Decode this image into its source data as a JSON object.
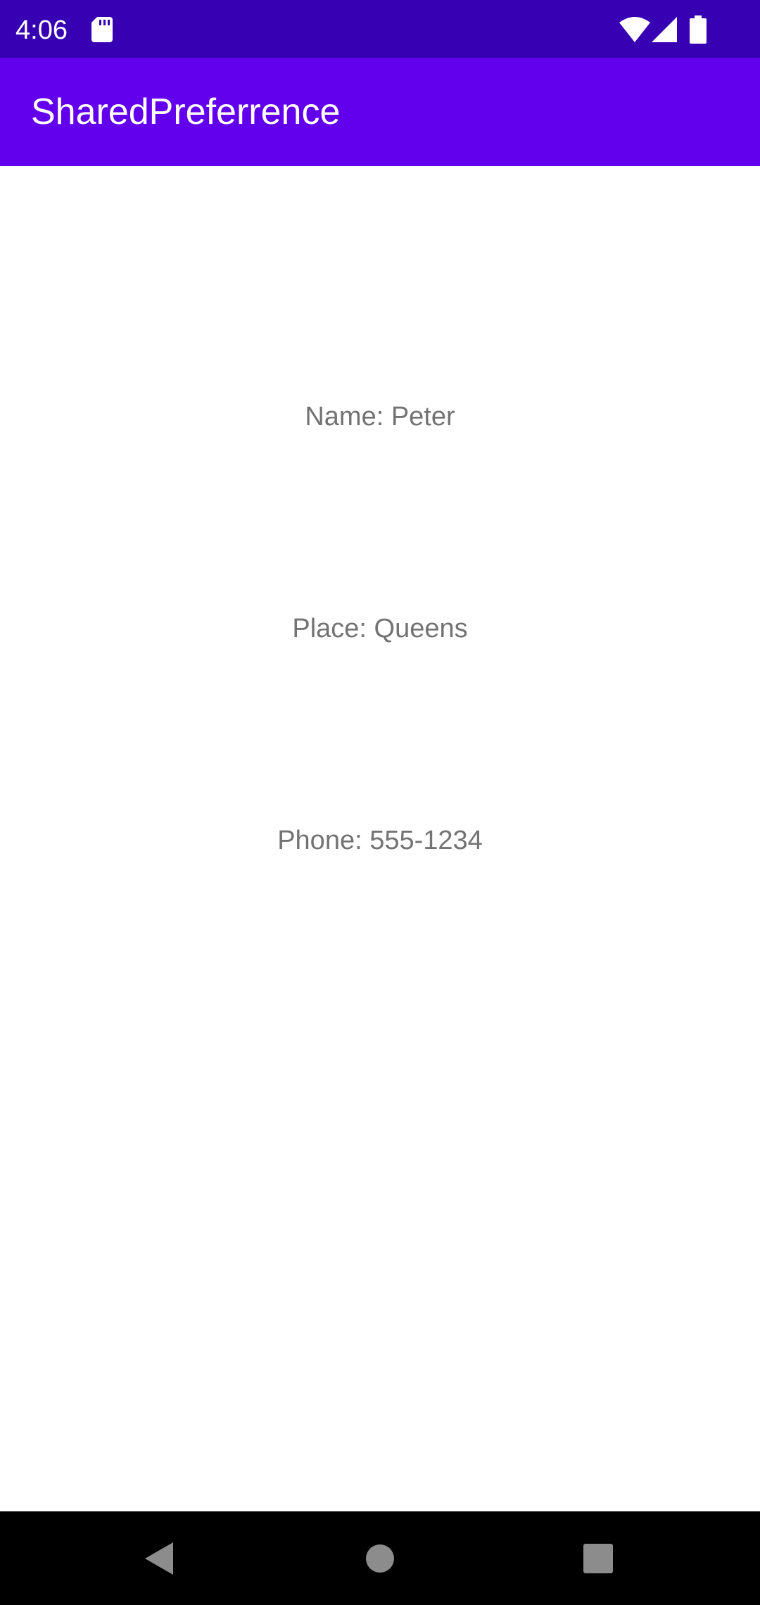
{
  "status_bar": {
    "time": "4:06",
    "icons": [
      "sd-card-icon",
      "wifi-icon",
      "cell-signal-icon",
      "battery-icon"
    ],
    "background": "#3700b3"
  },
  "app_bar": {
    "title": "SharedPreferrence",
    "background": "#6200ee"
  },
  "content": {
    "name_text": "Name: Peter",
    "place_text": "Place: Queens",
    "phone_text": "Phone: 555-1234",
    "text_color": "#737373"
  },
  "nav_bar": {
    "buttons": [
      "back-icon",
      "home-icon",
      "recents-icon"
    ],
    "background": "#000000"
  }
}
